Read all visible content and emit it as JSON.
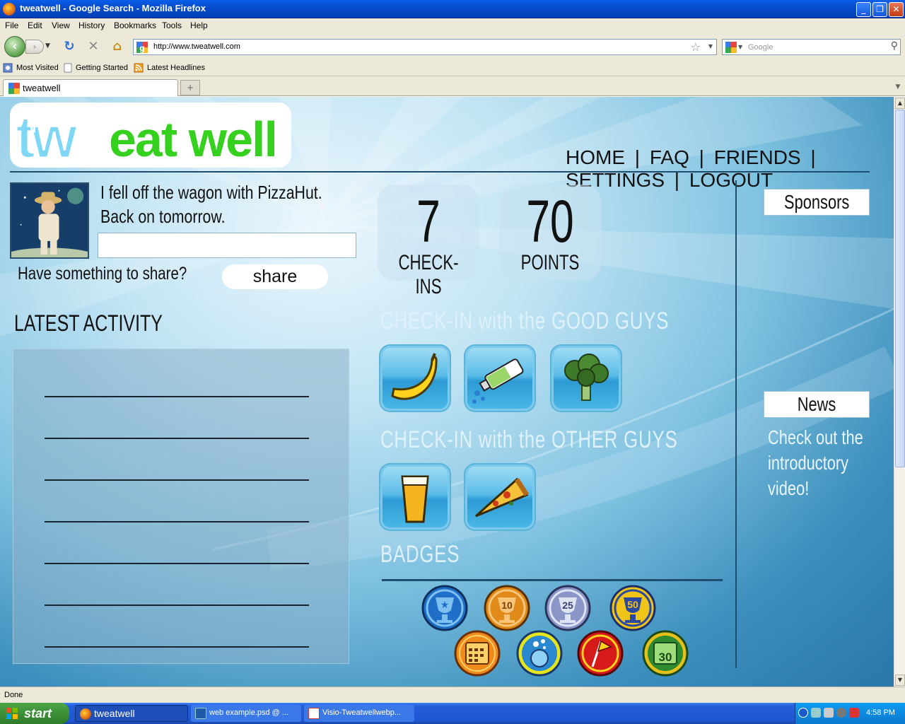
{
  "window": {
    "title": "tweatwell - Google Search - Mozilla Firefox",
    "controls": [
      "_",
      "❐",
      "✕"
    ]
  },
  "menu": [
    "File",
    "Edit",
    "View",
    "History",
    "Bookmarks",
    "Tools",
    "Help"
  ],
  "navbar": {
    "url": "http://www.tweatwell.com",
    "search_placeholder": "Google"
  },
  "bookmarks": [
    "Most Visited",
    "Getting Started",
    "Latest Headlines"
  ],
  "tabs": [
    {
      "label": "tweatwell"
    }
  ],
  "page": {
    "logo_left": "tw",
    "logo_right": "eat well",
    "nav": [
      "HOME",
      "FAQ",
      "FRIENDS",
      "SETTINGS",
      "LOGOUT"
    ],
    "nav_sep": "|",
    "status_line1": "I fell off the wagon with PizzaHut.",
    "status_line2": "Back on tomorrow.",
    "share_prompt": "Have something to share?",
    "share_button": "share",
    "latest_activity": "LATEST ACTIVITY",
    "stats": [
      {
        "value": "7",
        "label": "CHECK-INS"
      },
      {
        "value": "70",
        "label": "POINTS"
      }
    ],
    "good_guys_title": "CHECK-IN with the GOOD GUYS",
    "good_guys_icons": [
      "banana-icon",
      "toothpaste-icon",
      "broccoli-icon"
    ],
    "other_guys_title": "CHECK-IN with the OTHER GUYS",
    "other_guys_icons": [
      "beer-icon",
      "pizza-icon"
    ],
    "badges_title": "BADGES",
    "badges_row1": [
      {
        "icon": "trophy-star-badge-icon",
        "text": "★"
      },
      {
        "icon": "trophy-10-badge-icon",
        "text": "10"
      },
      {
        "icon": "trophy-25-badge-icon",
        "text": "25"
      },
      {
        "icon": "trophy-50-badge-icon",
        "text": "50"
      }
    ],
    "badges_row2": [
      {
        "icon": "calendar-badge-icon",
        "text": ""
      },
      {
        "icon": "bubbles-face-badge-icon",
        "text": ""
      },
      {
        "icon": "flag-badge-icon",
        "text": ""
      },
      {
        "icon": "calendar-30-badge-icon",
        "text": "30"
      }
    ],
    "sponsors": "Sponsors",
    "news": "News",
    "news_text": [
      "Check out the",
      "introductory",
      "video!"
    ]
  },
  "statusbar": "Done",
  "taskbar": {
    "start": "start",
    "items": [
      "tweatwell",
      "web example.psd @ ...",
      "Visio-Tweatwellwebp..."
    ],
    "clock": "4:58 PM"
  },
  "colors": {
    "logo_blue": "#7fd6f5",
    "logo_green": "#35d11e",
    "page_bg_dark": "#2a77a8",
    "page_bg_light": "#ecf7fd"
  }
}
